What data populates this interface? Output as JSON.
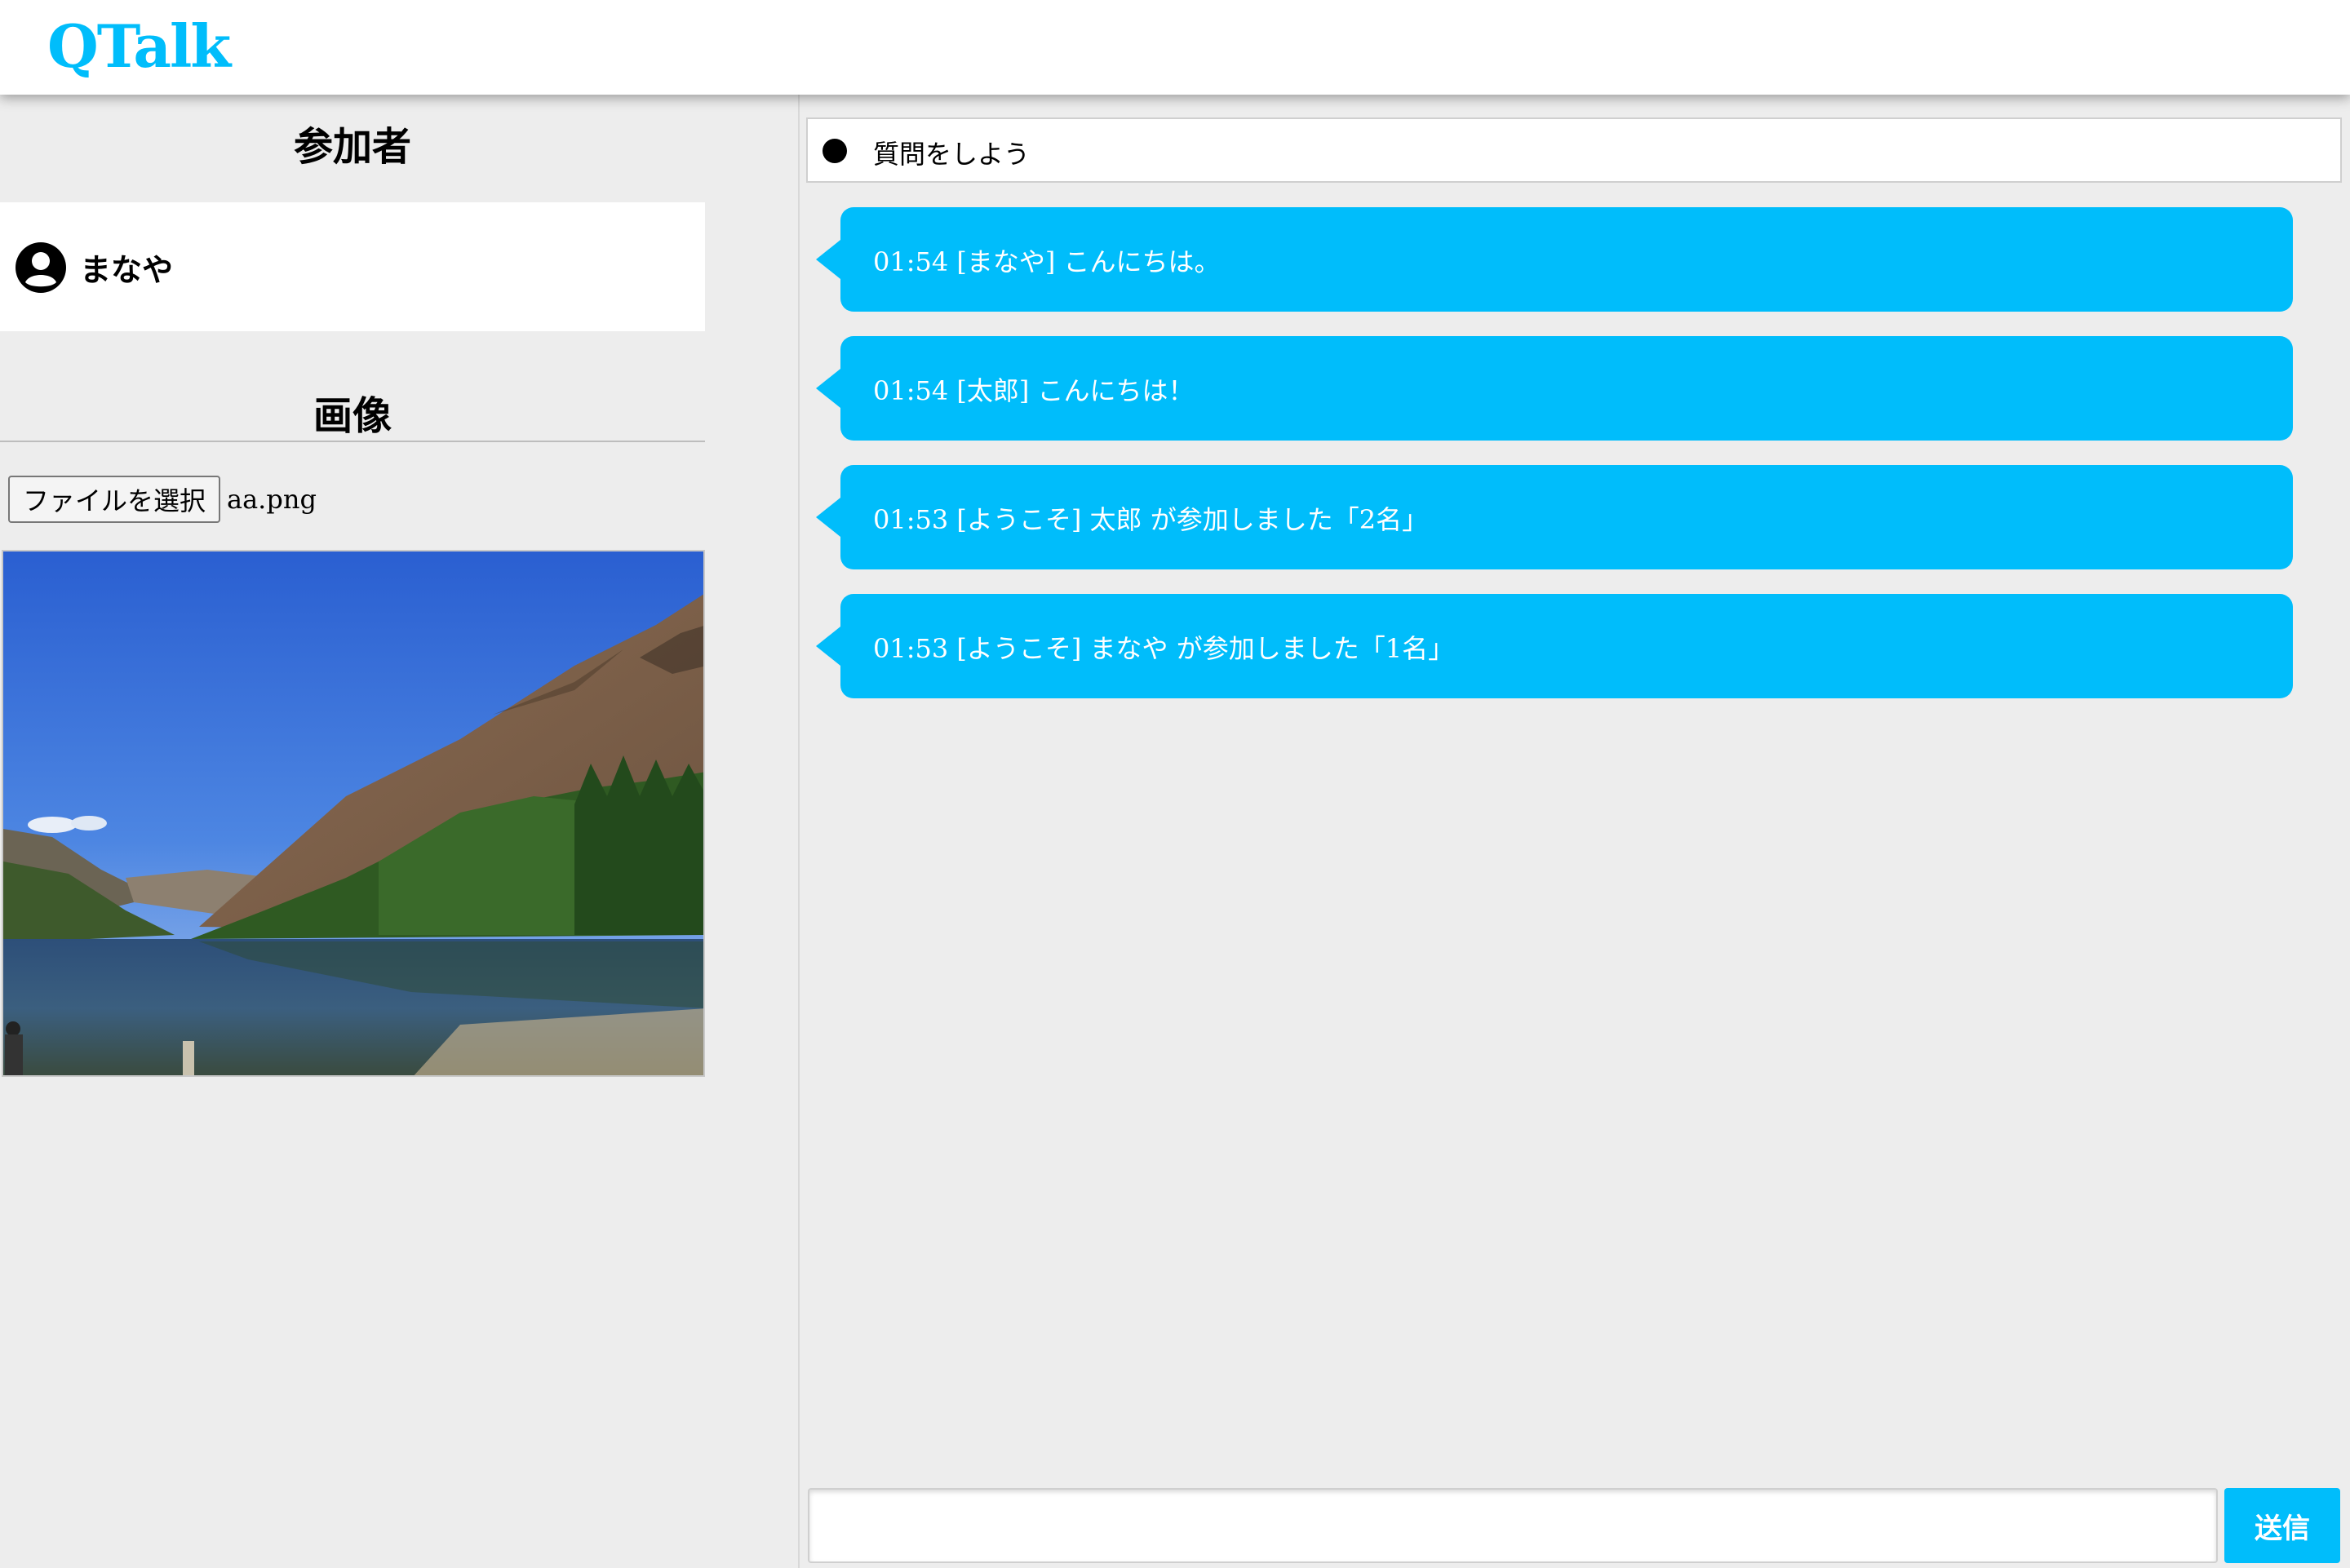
{
  "app": {
    "title": "QTalk",
    "accent_color": "#00bdfb"
  },
  "sidebar": {
    "participants_title": "参加者",
    "participants": [
      {
        "name": "まなや",
        "icon": "user-circle-icon"
      }
    ],
    "image_title": "画像",
    "file_button_label": "ファイルを選択",
    "file_name": "aa.png"
  },
  "chat": {
    "topic": "質問をしよう",
    "messages": [
      {
        "text": "01:54 [まなや] こんにちは。"
      },
      {
        "text": "01:54 [太郎] こんにちは！"
      },
      {
        "text": "01:53 [ようこそ] 太郎 が参加しました「2名」"
      },
      {
        "text": "01:53 [ようこそ] まなや が参加しました「1名」"
      }
    ],
    "input_value": "",
    "send_label": "送信"
  }
}
